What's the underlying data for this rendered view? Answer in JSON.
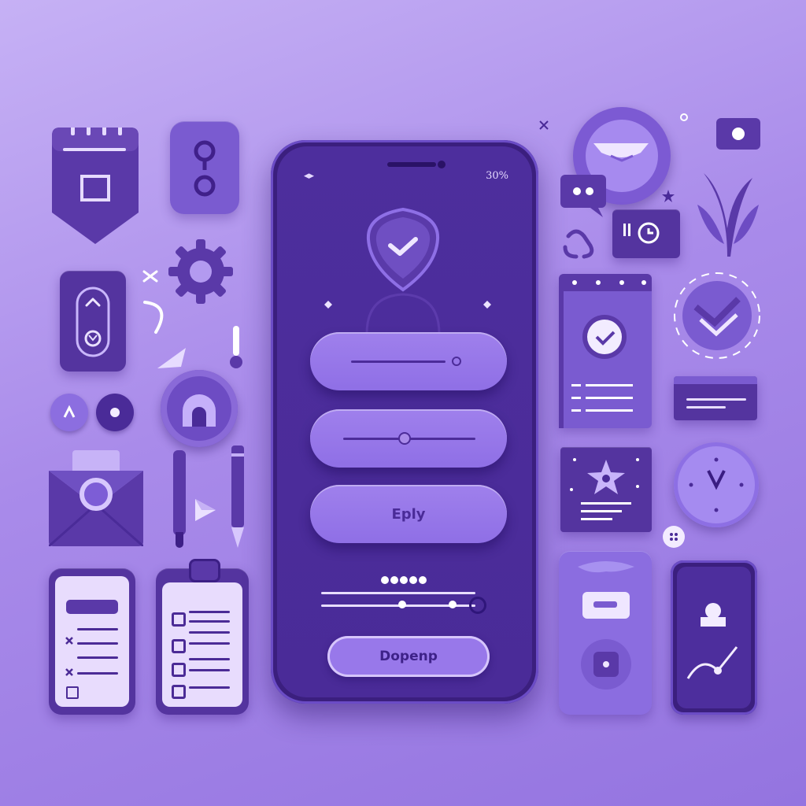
{
  "phone": {
    "status_left": "◂▸",
    "status_right": "30%",
    "primary_button_label": "Eply",
    "secondary_button_label": "Dopenp",
    "page_dots_count": 5
  },
  "colors": {
    "background": "#a98bea",
    "phone_body": "#3b1f7e",
    "screen": "#4d2e9d",
    "pill": "#9474e0",
    "accent_light": "#e1d3fb"
  },
  "icons": [
    "calendar-badge-icon",
    "toggle-card-icon",
    "settings-gear-icon",
    "security-card-icon",
    "mail-envelope-icon",
    "pen-icon",
    "pencil-icon",
    "checklist-card-icon",
    "clipboard-icon",
    "profile-badge-icon",
    "chat-bubble-icon",
    "plant-icon",
    "camera-card-icon",
    "check-circle-icon",
    "calendar-check-icon",
    "text-bar-icon",
    "star-card-icon",
    "clock-icon",
    "phone-card-icon",
    "chart-phone-icon"
  ]
}
